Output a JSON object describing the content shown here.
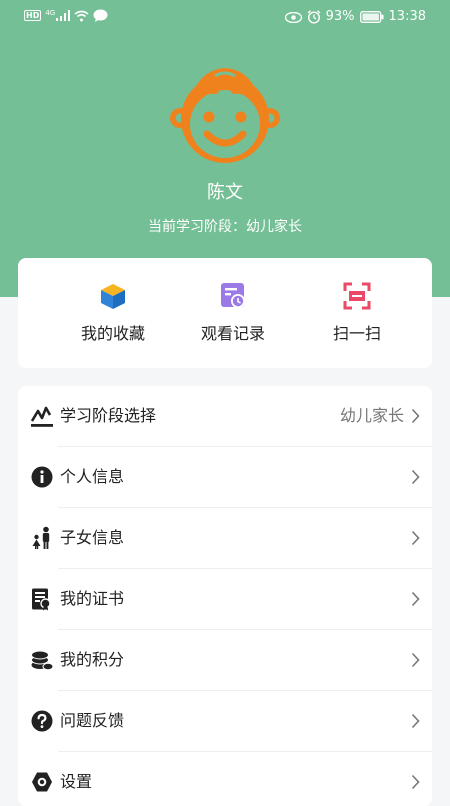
{
  "status_bar": {
    "network_type": "HD",
    "signal_label": "4G",
    "battery_percent": "93%",
    "time": "13:38",
    "icons": [
      "hd-icon",
      "signal-icon",
      "wifi-icon",
      "message-icon",
      "eye-icon",
      "alarm-icon",
      "battery-icon"
    ]
  },
  "profile": {
    "name": "陈文",
    "stage_text": "当前学习阶段：幼儿家长",
    "avatar_icon": "boy-avatar-icon"
  },
  "quick_actions": [
    {
      "label": "我的收藏",
      "icon": "cube-icon"
    },
    {
      "label": "观看记录",
      "icon": "history-icon"
    },
    {
      "label": "扫一扫",
      "icon": "scan-icon"
    }
  ],
  "menu": [
    {
      "label": "学习阶段选择",
      "value": "幼儿家长",
      "icon": "stage-icon"
    },
    {
      "label": "个人信息",
      "value": "",
      "icon": "info-icon"
    },
    {
      "label": "子女信息",
      "value": "",
      "icon": "family-icon"
    },
    {
      "label": "我的证书",
      "value": "",
      "icon": "certificate-icon"
    },
    {
      "label": "我的积分",
      "value": "",
      "icon": "coins-icon"
    },
    {
      "label": "问题反馈",
      "value": "",
      "icon": "question-icon"
    },
    {
      "label": "设置",
      "value": "",
      "icon": "settings-icon"
    }
  ],
  "colors": {
    "header_bg": "#74bf95",
    "avatar_orange": "#f0821e",
    "cube_blue": "#2f83d8",
    "cube_orange": "#f7b321",
    "history_purple": "#9b79e6",
    "scan_red": "#ea4a67"
  }
}
